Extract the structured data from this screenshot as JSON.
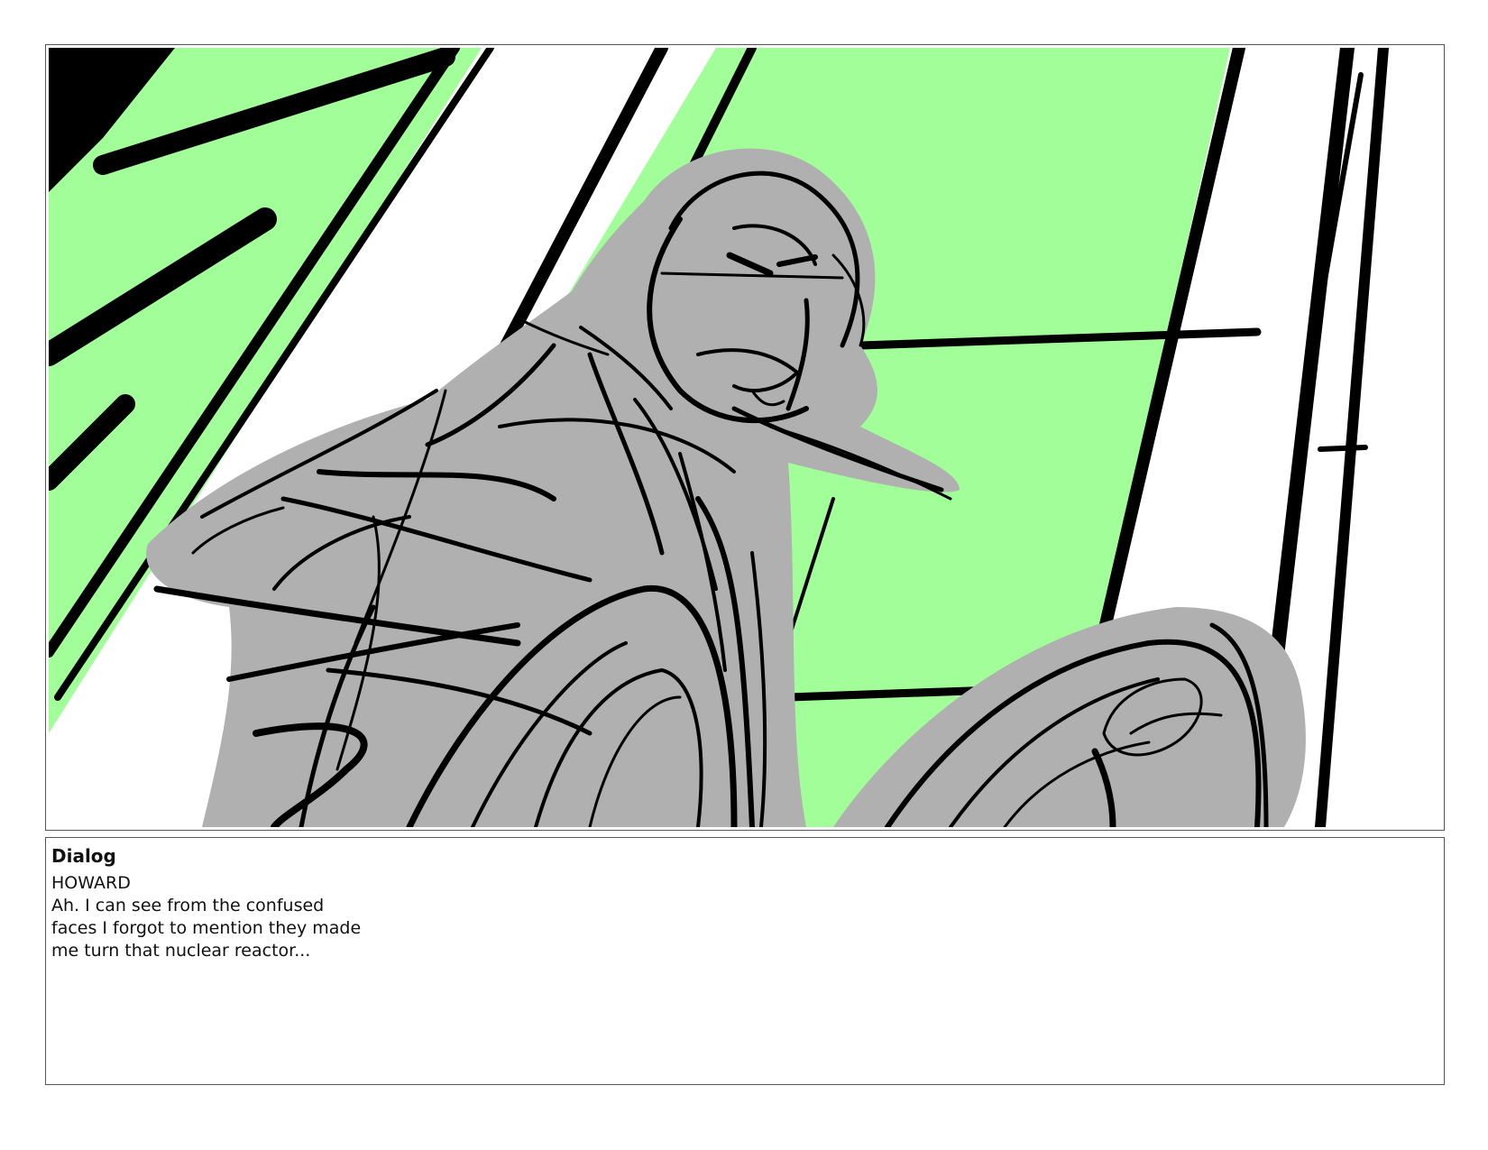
{
  "panel": {
    "colors": {
      "background": "#ffffff",
      "sky": "#a1fe98",
      "figure_fill": "#b0b0b0",
      "ink": "#000000",
      "frame_border": "#555555"
    },
    "subject": "storyboard-sketch-figure"
  },
  "notes": {
    "heading": "Dialog",
    "character": "HOWARD",
    "lines": [
      "Ah. I can see from the confused",
      "faces I forgot to mention they made",
      "me turn that nuclear reactor..."
    ]
  }
}
